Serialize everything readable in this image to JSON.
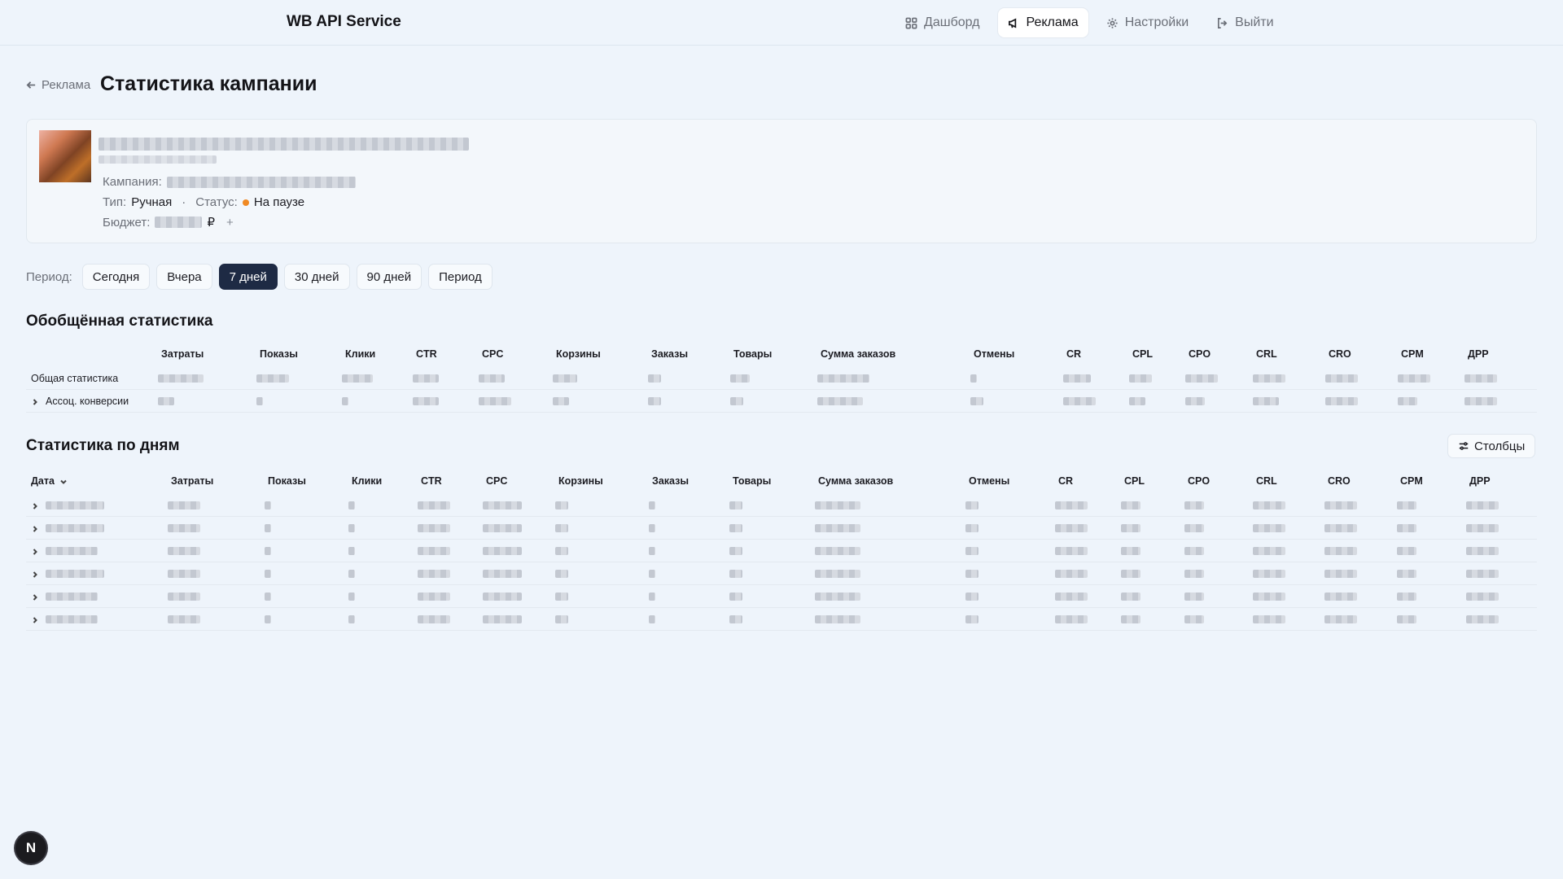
{
  "app": {
    "brand": "WB API Service",
    "nav": [
      {
        "label": "Дашборд",
        "icon": "dashboard-icon",
        "active": false
      },
      {
        "label": "Реклама",
        "icon": "megaphone-icon",
        "active": true
      },
      {
        "label": "Настройки",
        "icon": "gear-icon",
        "active": false
      },
      {
        "label": "Выйти",
        "icon": "logout-icon",
        "active": false
      }
    ]
  },
  "page": {
    "back_label": "Реклама",
    "title": "Статистика кампании"
  },
  "campaign_card": {
    "campaign_label": "Кампания:",
    "type_label": "Тип:",
    "type_value": "Ручная",
    "separator": "·",
    "status_label": "Статус:",
    "status_value": "На паузе",
    "status_color": "#f08a24",
    "budget_label": "Бюджет:",
    "currency": "₽",
    "add_label": "+"
  },
  "period": {
    "label": "Период:",
    "options": [
      "Сегодня",
      "Вчера",
      "7 дней",
      "30 дней",
      "90 дней",
      "Период"
    ],
    "selected": "7 дней"
  },
  "summary": {
    "title": "Обобщённая статистика",
    "columns": [
      "Затраты",
      "Показы",
      "Клики",
      "CTR",
      "CPC",
      "Корзины",
      "Заказы",
      "Товары",
      "Сумма заказов",
      "Отмены",
      "CR",
      "CPL",
      "CPO",
      "CRL",
      "CRO",
      "CPM",
      "ДРР"
    ],
    "rows": [
      {
        "label": "Общая статистика"
      },
      {
        "label": "Ассоц. конверсии"
      }
    ]
  },
  "daily": {
    "title": "Статистика по дням",
    "columns_button": "Столбцы",
    "date_column": "Дата",
    "columns": [
      "Затраты",
      "Показы",
      "Клики",
      "CTR",
      "CPC",
      "Корзины",
      "Заказы",
      "Товары",
      "Сумма заказов",
      "Отмены",
      "CR",
      "CPL",
      "CPO",
      "CRL",
      "CRO",
      "CPM",
      "ДРР"
    ]
  },
  "assistant_bubble": "N"
}
